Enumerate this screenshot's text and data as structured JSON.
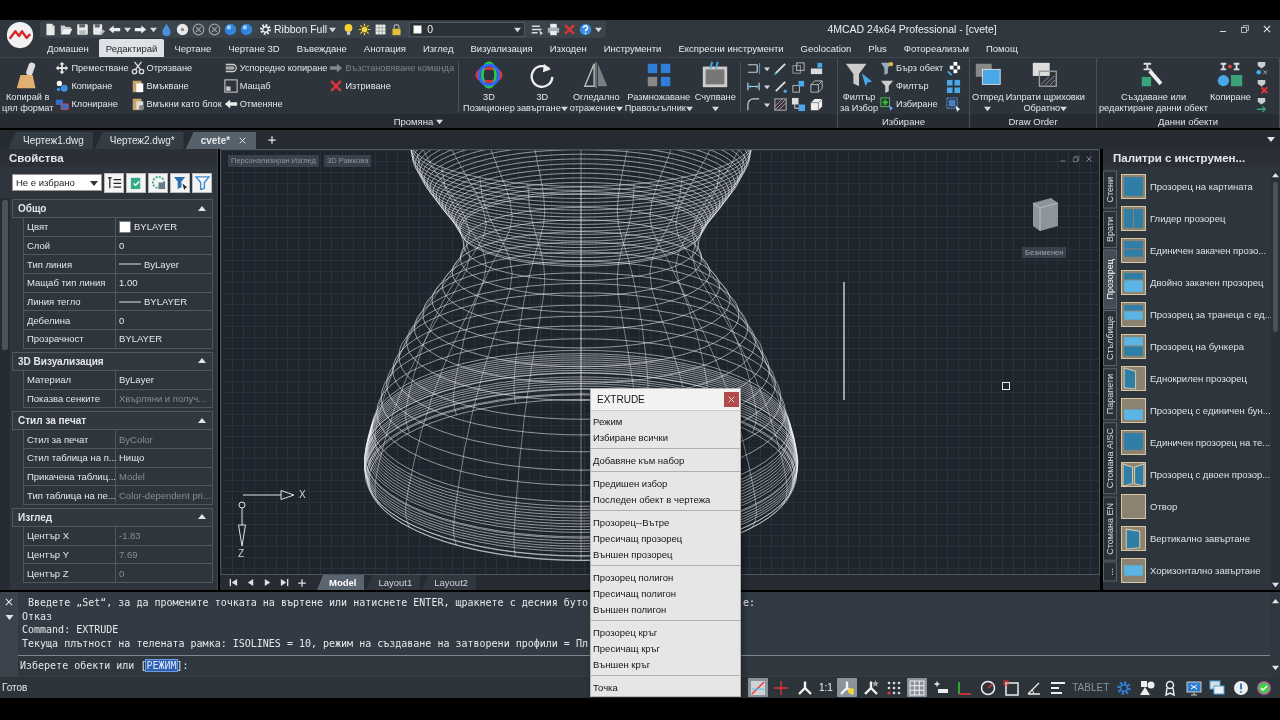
{
  "title_bar": {
    "title": "4MCAD 24x64 Professional - [cvete]",
    "workspace": "Ribbon Full",
    "layer": "0"
  },
  "ribbon_tabs": [
    {
      "label": "Домашен",
      "selected": false
    },
    {
      "label": "Редактирай",
      "selected": true
    },
    {
      "label": "Чертане",
      "selected": false
    },
    {
      "label": "Чертане 3D",
      "selected": false
    },
    {
      "label": "Въвеждане",
      "selected": false
    },
    {
      "label": "Анотация",
      "selected": false
    },
    {
      "label": "Изглед",
      "selected": false
    },
    {
      "label": "Визуализация",
      "selected": false
    },
    {
      "label": "Изходен",
      "selected": false
    },
    {
      "label": "Инструменти",
      "selected": false
    },
    {
      "label": "Експресни инструменти",
      "selected": false
    },
    {
      "label": "Geolocation",
      "selected": false
    },
    {
      "label": "Plus",
      "selected": false
    },
    {
      "label": "Фотореализъм",
      "selected": false
    },
    {
      "label": "Помощ",
      "selected": false
    }
  ],
  "ribbon": {
    "groups": [
      {
        "label": "Промяна",
        "caret": true,
        "tools": [
          {
            "kind": "large",
            "label": "Копирай в\nцял формат",
            "caret": false
          },
          {
            "kind": "column",
            "items": [
              {
                "label": "Преместване",
                "disabled": false
              },
              {
                "label": "Копиране",
                "disabled": false
              },
              {
                "label": "Клониране",
                "disabled": false
              }
            ]
          },
          {
            "kind": "column",
            "items": [
              {
                "label": "Отрязване",
                "disabled": false
              },
              {
                "label": "Вмъкване",
                "disabled": false
              },
              {
                "label": "Вмъкни като блок",
                "disabled": false
              }
            ]
          },
          {
            "kind": "column",
            "items": [
              {
                "label": "Успоредно копиране",
                "disabled": false
              },
              {
                "label": "Мащаб",
                "disabled": false
              },
              {
                "label": "Отменяне",
                "disabled": false
              }
            ]
          },
          {
            "kind": "column",
            "items": [
              {
                "label": "Възстановяване команда",
                "disabled": true
              },
              {
                "label": "Изтриване",
                "disabled": false
              }
            ]
          },
          {
            "kind": "separator"
          },
          {
            "kind": "large",
            "label": "3D\nПозиционер",
            "caret": false
          },
          {
            "kind": "large",
            "label": "3D\nзавъртане",
            "caret": true
          },
          {
            "kind": "large",
            "label": "Огледално\nотражение",
            "caret": true
          },
          {
            "kind": "large",
            "label": "Размножаване\nПравоъгълник",
            "caret": true
          },
          {
            "kind": "large",
            "label": "Счупване",
            "caret": true
          },
          {
            "kind": "separator"
          },
          {
            "kind": "icon_grid"
          }
        ]
      },
      {
        "label": "Избиране",
        "caret": false,
        "tools": [
          {
            "kind": "large",
            "label": "Филтър\nза Избор",
            "caret": false
          },
          {
            "kind": "column",
            "items": [
              {
                "label": "Бърз обект",
                "disabled": false
              },
              {
                "label": "Филтър",
                "disabled": false
              },
              {
                "label": "Избиране",
                "disabled": false
              }
            ]
          },
          {
            "kind": "icon_grid"
          }
        ]
      },
      {
        "label": "Draw Order",
        "caret": false,
        "tools": [
          {
            "kind": "large",
            "label": "Отпред",
            "caret": true
          },
          {
            "kind": "large",
            "label": "Изпрати щриховки\nОбратно",
            "caret": true
          }
        ]
      },
      {
        "label": "Данни обекти",
        "caret": false,
        "tools": [
          {
            "kind": "large",
            "label": "Създаване или\nредактиране данни обект",
            "caret": false
          },
          {
            "kind": "large",
            "label": "Копиране",
            "caret": false
          },
          {
            "kind": "icon_grid"
          }
        ]
      }
    ]
  },
  "document_tabs": [
    {
      "label": "Чертеж1.dwg",
      "selected": false
    },
    {
      "label": "Чертеж2.dwg*",
      "selected": false
    },
    {
      "label": "cvete*",
      "selected": true
    }
  ],
  "properties": {
    "title": "Свойства",
    "selection": "Не е избрано",
    "sections": [
      {
        "title": "Общо",
        "expanded": true,
        "rows": [
          {
            "label": "Цвят",
            "value": "BYLAYER",
            "kind": "swatch",
            "disabled": false
          },
          {
            "label": "Слой",
            "value": "0",
            "kind": "text",
            "disabled": false
          },
          {
            "label": "Тип линия",
            "value": "ByLayer",
            "kind": "linetype",
            "disabled": false
          },
          {
            "label": "Мащаб тип линия",
            "value": "1.00",
            "kind": "text",
            "disabled": false
          },
          {
            "label": "Линия тегло",
            "value": "BYLAYER",
            "kind": "linetype",
            "disabled": false
          },
          {
            "label": "Дебелина",
            "value": "0",
            "kind": "text",
            "disabled": false
          },
          {
            "label": "Прозрачност",
            "value": "BYLAYER",
            "kind": "text",
            "disabled": false
          }
        ]
      },
      {
        "title": "3D Визуализация",
        "expanded": true,
        "rows": [
          {
            "label": "Материал",
            "value": "ByLayer",
            "kind": "text",
            "disabled": false
          },
          {
            "label": "Показва сенките",
            "value": "Хвърляни и получ...",
            "kind": "text",
            "disabled": true
          }
        ]
      },
      {
        "title": "Стил за печат",
        "expanded": true,
        "rows": [
          {
            "label": "Стил за печат",
            "value": "ByColor",
            "kind": "text",
            "disabled": true
          },
          {
            "label": "Стил таблица на п...",
            "value": "Нищо",
            "kind": "text",
            "disabled": false
          },
          {
            "label": "Прикачена таблиц...",
            "value": "Model",
            "kind": "text",
            "disabled": true
          },
          {
            "label": "Тип таблица на пе...",
            "value": "Color-dependent pri...",
            "kind": "text",
            "disabled": true
          }
        ]
      },
      {
        "title": "Изглед",
        "expanded": true,
        "rows": [
          {
            "label": "Център X",
            "value": "-1.83",
            "kind": "text",
            "disabled": true
          },
          {
            "label": "Център Y",
            "value": "7.69",
            "kind": "text",
            "disabled": true
          },
          {
            "label": "Център Z",
            "value": "0",
            "kind": "text",
            "disabled": true
          }
        ]
      }
    ]
  },
  "viewport": {
    "view_label": "Персонализиран Изглед",
    "style_label": "3D Рамкова",
    "view_name": "Безименен",
    "axis_labels": [
      "X",
      "Z"
    ],
    "layout_tabs": [
      {
        "label": "Model",
        "selected": true
      },
      {
        "label": "Layout1",
        "selected": false
      },
      {
        "label": "Layout2",
        "selected": false
      }
    ]
  },
  "tool_palette": {
    "title": "Палитри с инструмен...",
    "tabs": [
      {
        "label": "Стени",
        "selected": false
      },
      {
        "label": "Врати",
        "selected": false
      },
      {
        "label": "Прозорец",
        "selected": true
      },
      {
        "label": "Стълбище",
        "selected": false
      },
      {
        "label": "Парапети",
        "selected": false
      },
      {
        "label": "Стомана AISC",
        "selected": false
      },
      {
        "label": "Стомана EN",
        "selected": false
      },
      {
        "label": "...",
        "selected": false
      }
    ],
    "items": [
      "Прозорец на картината",
      "Глидер прозорец",
      "Единичен закачен прозо...",
      "Двойно закачен прозорец",
      "Прозорец за транеца с ед...",
      "Прозорец на бункера",
      "Еднокрилен прозорец",
      "Прозорец с единичен бун...",
      "Единичен прозорец на те...",
      "Прозорец с двоен прозор...",
      "Отвор",
      "Вертикално завъртане",
      "Хоризонтално завъртане"
    ]
  },
  "context_menu": {
    "title": "EXTRUDE",
    "groups": [
      [
        "Режим",
        "Избиране всички"
      ],
      [
        "Добавяне към набор"
      ],
      [
        "Предишен избор",
        "Последен обект в чертежа"
      ],
      [
        "Прозорец--Вътре",
        "Пресичащ прозорец",
        "Външен прозорец"
      ],
      [
        "Прозорец полигон",
        "Пресичащ полигон",
        "Външен полигон"
      ],
      [
        "Прозорец кръг",
        "Пресичащ кръг",
        "Външен кръг"
      ],
      [
        "Точка"
      ]
    ]
  },
  "command_line": {
    "lines": [
      {
        "text": " Введете „Set“, за да промените точката на въртене или натиснете ENTER, щракнете с десния буто",
        "tail": "е:"
      },
      {
        "text": "Отказ"
      },
      {
        "text": "Command: EXTRUDE"
      },
      {
        "text": "Текуща плътност на телената рамка: ISOLINES = 10, режим на създаване на затворени профили = Пл"
      }
    ],
    "prompt": {
      "before": "Изберете обекти или [",
      "option": "РЕЖИМ",
      "after": "]:"
    }
  },
  "status_bar": {
    "status": "Готов",
    "items": [
      {
        "kind": "icon",
        "on": true
      },
      {
        "kind": "icon",
        "on": false
      },
      {
        "kind": "icon",
        "on": false
      },
      {
        "kind": "text",
        "label": "1:1",
        "on": true
      },
      {
        "kind": "icon",
        "on": true
      },
      {
        "kind": "icon",
        "on": false
      },
      {
        "kind": "icon",
        "on": false
      },
      {
        "kind": "icon",
        "on": true
      },
      {
        "kind": "icon",
        "on": false
      },
      {
        "kind": "icon",
        "on": false
      },
      {
        "kind": "icon",
        "on": false
      },
      {
        "kind": "icon",
        "on": false
      },
      {
        "kind": "icon",
        "on": false
      },
      {
        "kind": "icon",
        "on": false
      },
      {
        "kind": "text",
        "label": "TABLET",
        "on": false
      },
      {
        "kind": "icon",
        "on": false
      },
      {
        "kind": "icon",
        "on": false
      },
      {
        "kind": "icon",
        "on": false
      },
      {
        "kind": "icon",
        "on": false
      },
      {
        "kind": "icon",
        "on": false
      },
      {
        "kind": "icon",
        "on": false
      },
      {
        "kind": "icon",
        "on": false
      }
    ]
  }
}
